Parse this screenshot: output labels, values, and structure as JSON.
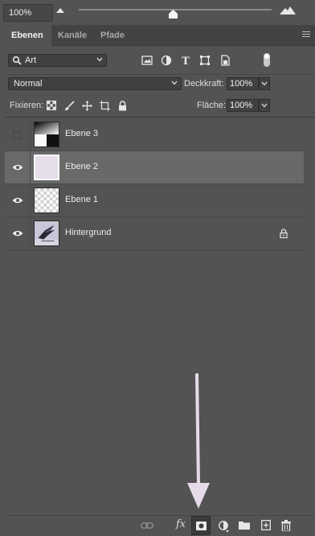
{
  "zoom": {
    "value": "100%"
  },
  "tabs": [
    {
      "label": "Ebenen",
      "active": true
    },
    {
      "label": "Kanäle",
      "active": false
    },
    {
      "label": "Pfade",
      "active": false
    }
  ],
  "filter": {
    "kind_label": "Art"
  },
  "blend": {
    "mode": "Normal",
    "opacity_label": "Deckkraft:",
    "opacity_value": "100%"
  },
  "lock": {
    "label": "Fixieren:",
    "fill_label": "Fläche:",
    "fill_value": "100%"
  },
  "layers": [
    {
      "name": "Ebene 3",
      "visible": false,
      "thumbnail": "black-white-gradient"
    },
    {
      "name": "Ebene 2",
      "visible": true,
      "selected": true,
      "thumbnail": "light-lavender-fill"
    },
    {
      "name": "Ebene 1",
      "visible": true,
      "thumbnail": "transparent-checkerboard"
    },
    {
      "name": "Hintergrund",
      "visible": true,
      "locked": true,
      "thumbnail": "bird-photo"
    }
  ],
  "bottom_icons": [
    "link-icon",
    "fx-icon",
    "add-mask-icon",
    "adjustment-layer-icon",
    "folder-icon",
    "new-layer-icon",
    "trash-icon"
  ],
  "bottom": {
    "fx_label": "fx"
  },
  "colors": {
    "panel_bg": "#535353",
    "selected_row": "#696969",
    "annotation_arrow": "#e6dbe8"
  }
}
